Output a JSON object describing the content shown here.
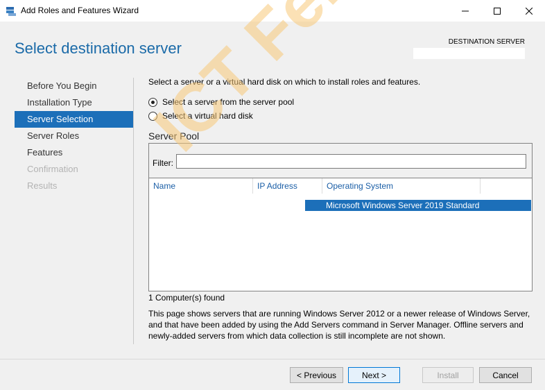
{
  "window": {
    "title": "Add Roles and Features Wizard",
    "minimize_icon": "minimize-icon",
    "maximize_icon": "maximize-icon",
    "close_icon": "close-icon"
  },
  "header": {
    "page_title": "Select destination server",
    "destination_label": "DESTINATION SERVER"
  },
  "nav": {
    "items": [
      {
        "label": "Before You Begin",
        "state": "normal"
      },
      {
        "label": "Installation Type",
        "state": "normal"
      },
      {
        "label": "Server Selection",
        "state": "active"
      },
      {
        "label": "Server Roles",
        "state": "normal"
      },
      {
        "label": "Features",
        "state": "normal"
      },
      {
        "label": "Confirmation",
        "state": "disabled"
      },
      {
        "label": "Results",
        "state": "disabled"
      }
    ]
  },
  "main": {
    "instruction": "Select a server or a virtual hard disk on which to install roles and features.",
    "radio_options": [
      {
        "label": "Select a server from the server pool",
        "checked": true
      },
      {
        "label": "Select a virtual hard disk",
        "checked": false
      }
    ],
    "pool_heading": "Server Pool",
    "filter_label": "Filter:",
    "filter_value": "",
    "columns": [
      "Name",
      "IP Address",
      "Operating System"
    ],
    "rows": [
      {
        "name": "",
        "ip": "",
        "os": "Microsoft Windows Server 2019 Standard",
        "selected": true
      }
    ],
    "found_text": "1 Computer(s) found",
    "description": "This page shows servers that are running Windows Server 2012 or a newer release of Windows Server, and that have been added by using the Add Servers command in Server Manager. Offline servers and newly-added servers from which data collection is still incomplete are not shown."
  },
  "footer": {
    "previous_label": "< Previous",
    "next_label": "Next >",
    "install_label": "Install",
    "cancel_label": "Cancel"
  },
  "watermark": "ICT Fella",
  "colors": {
    "accent": "#1c6fb9",
    "heading": "#1a6aa8"
  }
}
